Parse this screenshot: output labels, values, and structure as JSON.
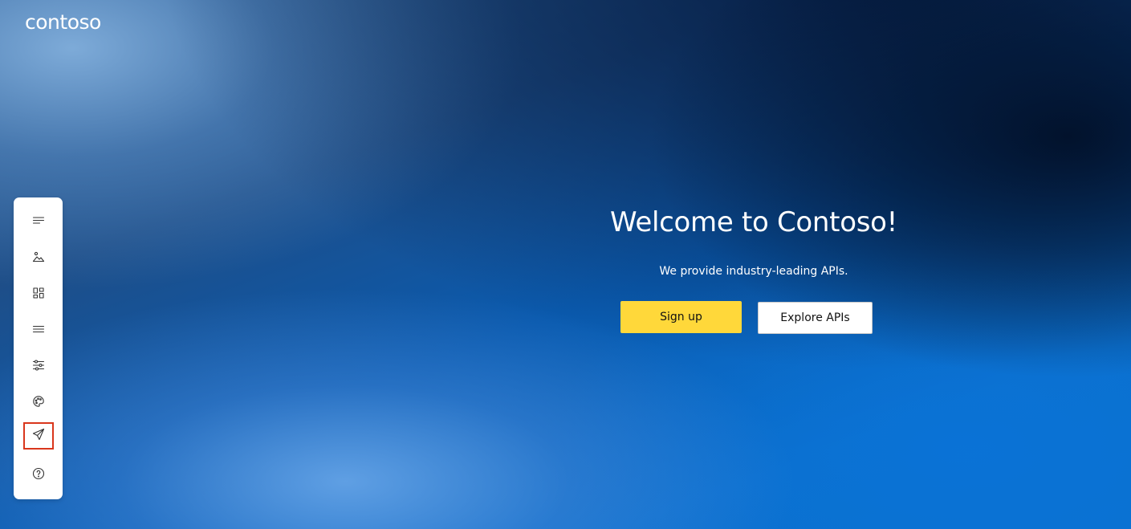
{
  "brand": {
    "logo_text": "contoso"
  },
  "sidebar": {
    "items": [
      {
        "icon": "text-lines-icon",
        "selected": false
      },
      {
        "icon": "image-icon",
        "selected": false
      },
      {
        "icon": "widgets-icon",
        "selected": false
      },
      {
        "icon": "menu-icon",
        "selected": false
      },
      {
        "icon": "sliders-icon",
        "selected": false
      },
      {
        "icon": "palette-icon",
        "selected": false
      },
      {
        "icon": "send-icon",
        "selected": true
      },
      {
        "icon": "help-icon",
        "selected": false
      }
    ],
    "selected_outline_color": "#d9361c"
  },
  "hero": {
    "title": "Welcome to Contoso!",
    "subtitle": "We provide industry-leading APIs.",
    "primary_button": "Sign up",
    "secondary_button": "Explore APIs"
  },
  "colors": {
    "primary_button_bg": "#ffd83a",
    "secondary_button_bg": "#ffffff",
    "text_on_hero": "#ffffff"
  }
}
